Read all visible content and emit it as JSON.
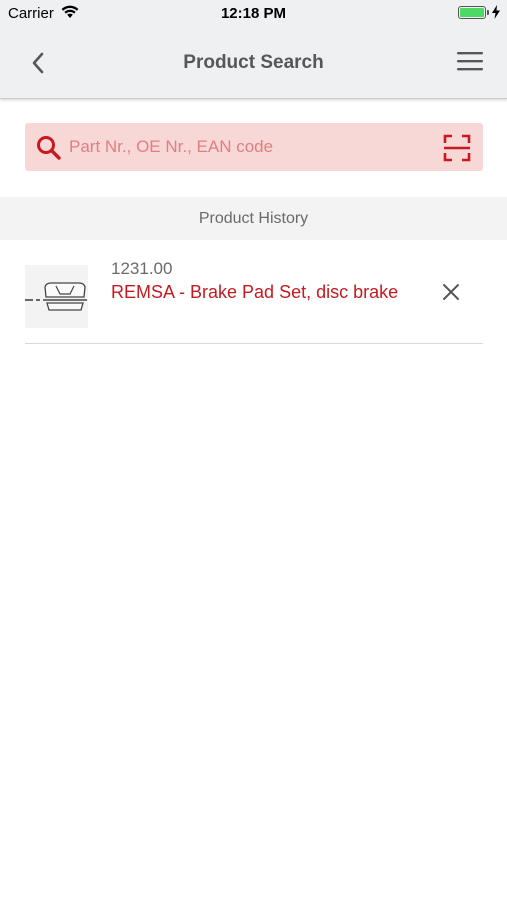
{
  "status_bar": {
    "carrier": "Carrier",
    "time": "12:18 PM",
    "battery_level": 1.0
  },
  "nav": {
    "title": "Product Search",
    "back_icon": "chevron-left-icon",
    "menu_icon": "hamburger-menu-icon"
  },
  "search": {
    "placeholder": "Part Nr., OE Nr., EAN code",
    "value": "",
    "search_icon": "search-icon",
    "scan_icon": "barcode-scan-icon"
  },
  "history": {
    "header": "Product History",
    "items": [
      {
        "number": "1231.00",
        "title": "REMSA - Brake Pad Set, disc brake",
        "thumbnail_icon": "brake-pad-icon",
        "remove_icon": "close-icon"
      }
    ]
  },
  "colors": {
    "accent": "#c9191e",
    "search_bg": "#f8d7d7",
    "header_bg": "#eef0f2",
    "battery": "#4cd964"
  }
}
